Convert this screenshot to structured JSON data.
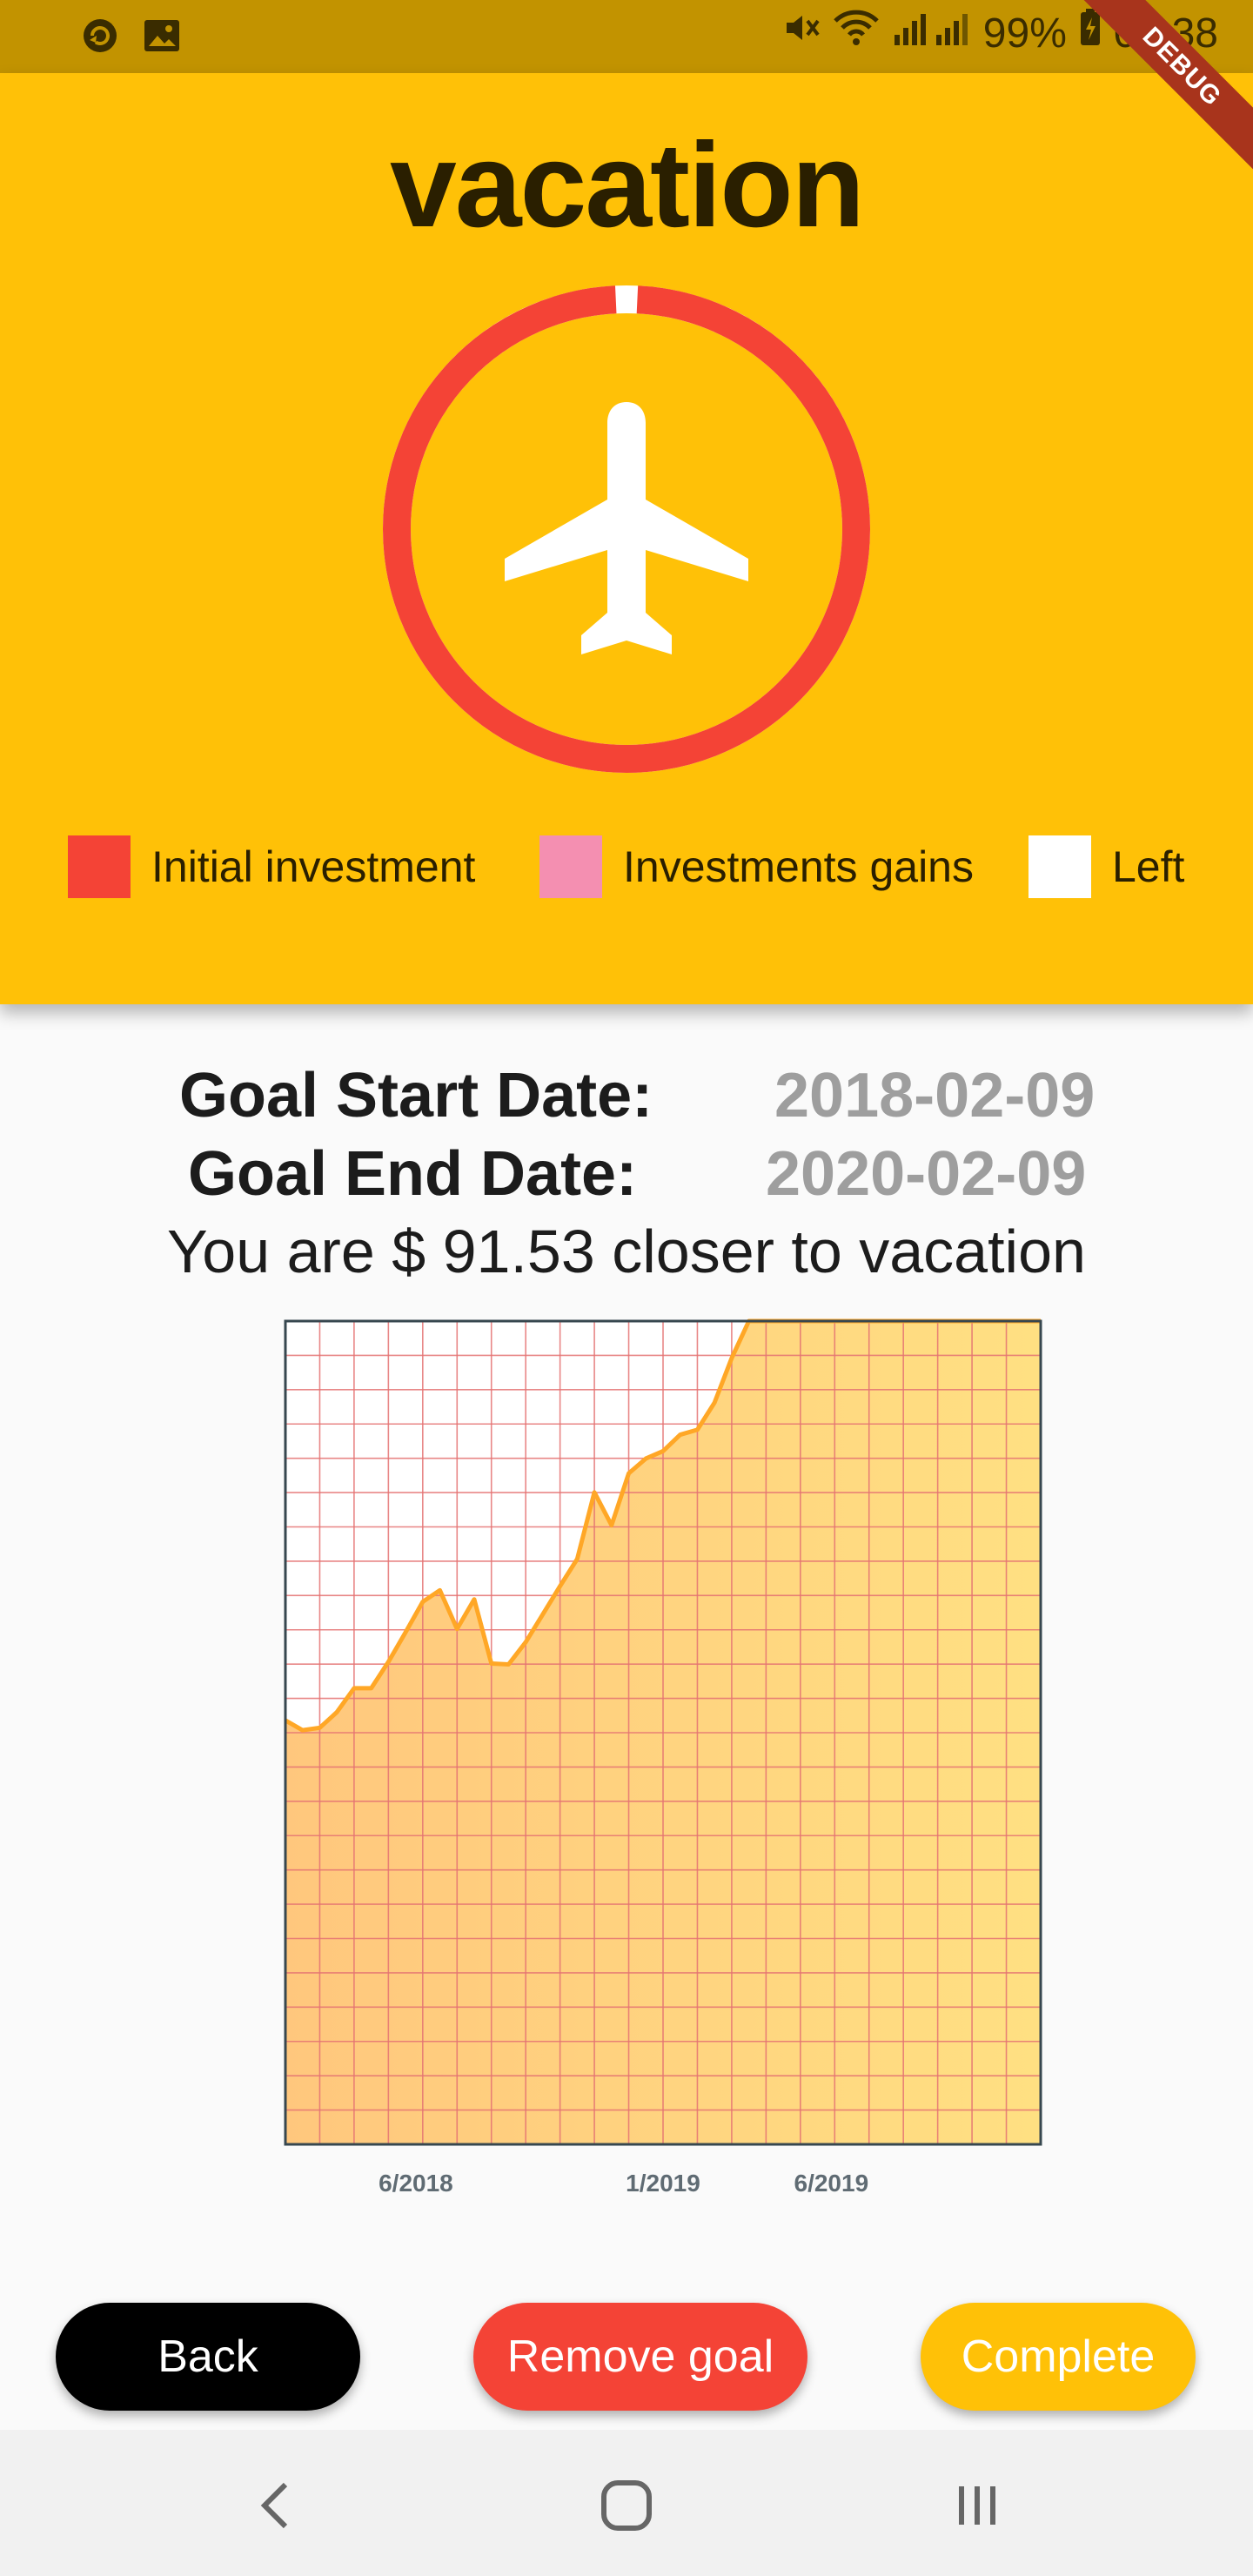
{
  "status_bar": {
    "battery": "99%",
    "time": "08:38"
  },
  "debug_banner": {
    "label": "DEBUG"
  },
  "goal": {
    "title": "vacation",
    "icon": "airplane-icon",
    "progress_fraction": 0.985,
    "ring_color": "#f44336",
    "left_color": "#ffffff"
  },
  "legend": [
    {
      "label": "Initial investment",
      "color": "#f44336"
    },
    {
      "label": "Investments gains",
      "color": "#f48fb1"
    },
    {
      "label": "Left",
      "color": "#ffffff"
    }
  ],
  "info": {
    "start_label": "Goal Start Date:",
    "start_value": "2018-02-09",
    "end_label": "Goal End Date:",
    "end_value": "2020-02-09",
    "closer_text": "You are $ 91.53 closer to vacation"
  },
  "chart_data": {
    "type": "area",
    "x_tick_labels": [
      "6/2018",
      "1/2019",
      "6/2019"
    ],
    "x_ticks": [
      3.8,
      11,
      15.9
    ],
    "x": [
      0,
      0.5,
      1,
      1.5,
      2,
      2.5,
      3,
      3.5,
      4,
      4.5,
      5,
      5.5,
      6,
      6.5,
      7,
      7.5,
      8,
      8.5,
      9,
      9.5,
      10,
      10.5,
      11,
      11.5,
      12,
      12.5,
      13,
      13.5,
      14,
      14.5,
      15,
      15.5,
      16,
      16.5,
      17,
      17.5,
      18,
      18.5,
      19,
      19.5,
      20,
      20.5,
      21,
      21.5,
      22
    ],
    "values": [
      51.5,
      50.3,
      50.6,
      52.5,
      55.4,
      55.4,
      58.6,
      62.2,
      65.9,
      67.3,
      62.6,
      66.2,
      58.4,
      58.3,
      61.0,
      64.4,
      67.8,
      71.1,
      79.2,
      75.2,
      81.5,
      83.3,
      84.2,
      86.2,
      86.8,
      90.1,
      95.5,
      100,
      100,
      100,
      100,
      100,
      100,
      100,
      100,
      100,
      100,
      100,
      100,
      100,
      100,
      100,
      100,
      100,
      100
    ],
    "xlim": [
      0,
      22
    ],
    "ylim": [
      0,
      100
    ],
    "grid": true,
    "line_color": "#ffa726",
    "fill_gradient": [
      "#ffc77d",
      "#ffe082"
    ],
    "grid_color": "#e57373"
  },
  "buttons": {
    "back": "Back",
    "remove": "Remove goal",
    "complete": "Complete"
  }
}
